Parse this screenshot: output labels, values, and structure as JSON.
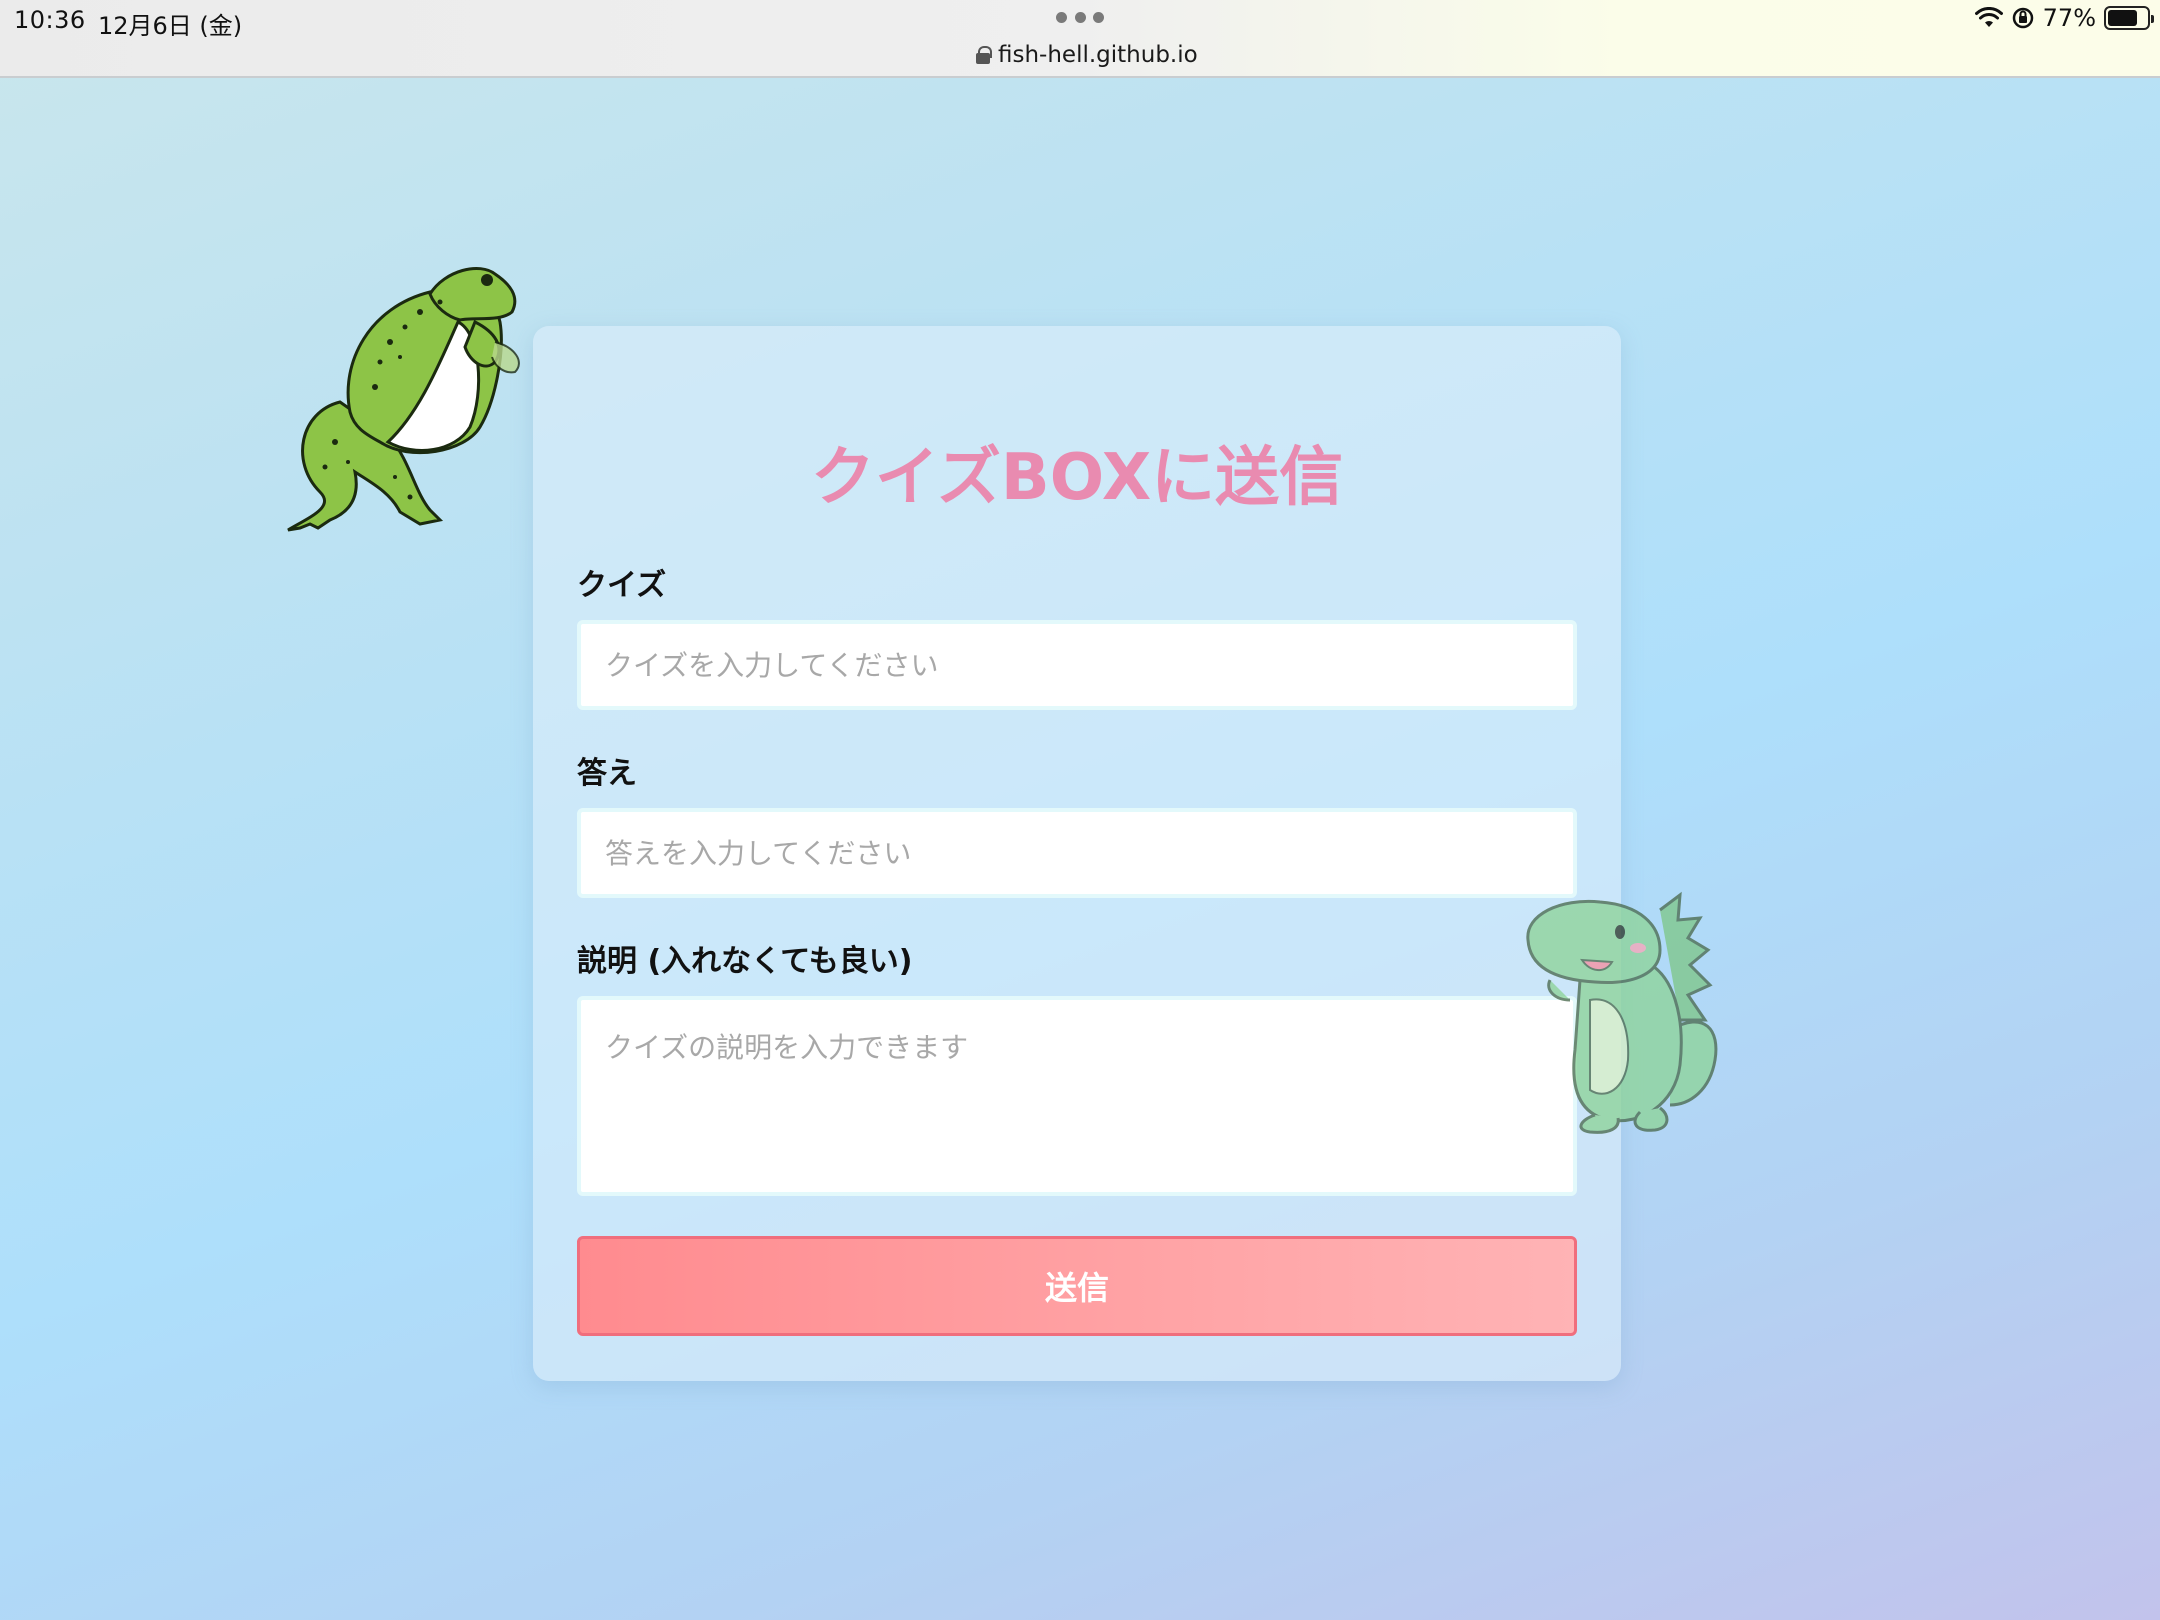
{
  "statusbar": {
    "time": "10:36",
    "date": "12月6日 (金)",
    "url": "fish-hell.github.io",
    "battery": "77%"
  },
  "form": {
    "title": "クイズBOXに送信",
    "quiz_label": "クイズ",
    "quiz_placeholder": "クイズを入力してください",
    "answer_label": "答え",
    "answer_placeholder": "答えを入力してください",
    "description_label": "説明 (入れなくても良い)",
    "description_placeholder": "クイズの説明を入力できます",
    "submit_label": "送信"
  },
  "colors": {
    "title": "#e98bb0",
    "submit_bg": "#ff8b8f",
    "submit_border": "#f06e7d"
  },
  "icons": [
    "lock-icon",
    "wifi-icon",
    "orientation-lock-icon",
    "battery-icon",
    "more-dots-icon"
  ]
}
